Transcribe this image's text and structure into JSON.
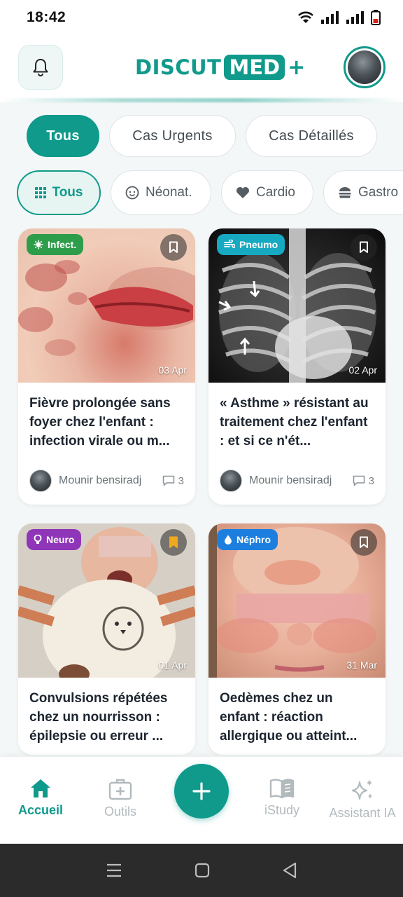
{
  "status": {
    "time": "18:42"
  },
  "header": {
    "logo_part1": "DISCUT",
    "logo_part2": "MED",
    "logo_plus": "+"
  },
  "filters_primary": [
    {
      "label": "Tous",
      "active": true
    },
    {
      "label": "Cas Urgents",
      "active": false
    },
    {
      "label": "Cas Détaillés",
      "active": false
    }
  ],
  "filters_specialty": [
    {
      "label": "Tous",
      "icon": "grid-icon",
      "active": true
    },
    {
      "label": "Néonat.",
      "icon": "baby-face-icon",
      "active": false
    },
    {
      "label": "Cardio",
      "icon": "heart-icon",
      "active": false
    },
    {
      "label": "Gastro",
      "icon": "burger-icon",
      "active": false
    }
  ],
  "cards": [
    {
      "tag": "Infect.",
      "tag_color": "#2e9d4a",
      "date": "03 Apr",
      "title": "Fièvre prolongée sans foyer chez l'enfant : infection virale ou m...",
      "author": "Mounir bensiradj",
      "comments": "3",
      "bookmarked": false
    },
    {
      "tag": "Pneumo",
      "tag_color": "#16a9c1",
      "date": "02 Apr",
      "title": "« Asthme » résistant au traitement chez l'enfant : et si ce n'ét...",
      "author": "Mounir bensiradj",
      "comments": "3",
      "bookmarked": false
    },
    {
      "tag": "Neuro",
      "tag_color": "#8e35b8",
      "date": "01 Apr",
      "title": "Convulsions répétées chez un nourrisson : épilepsie ou erreur ...",
      "bookmarked": true
    },
    {
      "tag": "Néphro",
      "tag_color": "#1c7fe0",
      "date": "31 Mar",
      "title": "Oedèmes chez un enfant : réaction allergique ou atteint...",
      "bookmarked": false
    }
  ],
  "bottom_nav": {
    "home": "Accueil",
    "tools": "Outils",
    "study": "iStudy",
    "assistant": "Assistant IA"
  },
  "colors": {
    "accent": "#0f9a8b",
    "inactive": "#b3babe"
  }
}
